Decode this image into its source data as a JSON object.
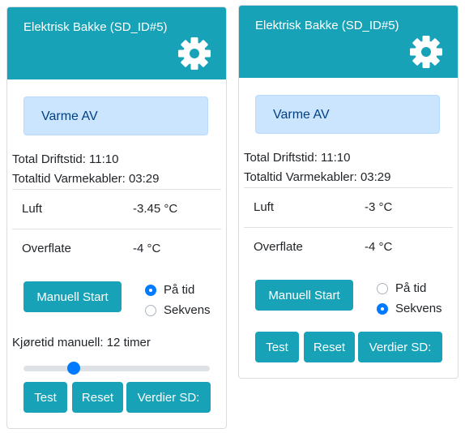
{
  "cards": [
    {
      "title": "Elektrisk Bakke (SD_ID#5)",
      "status": "Varme AV",
      "total_driftstid": "Total Driftstid: 11:10",
      "totaltid_varmekabler": "Totaltid Varmekabler: 03:29",
      "sensors": [
        {
          "name": "Luft",
          "value": "-3.45 °C"
        },
        {
          "name": "Overflate",
          "value": "-4 °C"
        }
      ],
      "manual_start": "Manuell Start",
      "mode_options": [
        "På tid",
        "Sekvens"
      ],
      "mode_selected": "På tid",
      "runtime_label": "Kjøretid manuell: 12 timer",
      "runtime_slider_fraction": 0.27,
      "buttons": [
        "Test",
        "Reset",
        "Verdier SD:"
      ]
    },
    {
      "title": "Elektrisk Bakke (SD_ID#5)",
      "status": "Varme AV",
      "total_driftstid": "Total Driftstid: 11:10",
      "totaltid_varmekabler": "Totaltid Varmekabler: 03:29",
      "sensors": [
        {
          "name": "Luft",
          "value": "-3 °C"
        },
        {
          "name": "Overflate",
          "value": "-4 °C"
        }
      ],
      "manual_start": "Manuell Start",
      "mode_options": [
        "På tid",
        "Sekvens"
      ],
      "mode_selected": "Sekvens",
      "buttons": [
        "Test",
        "Reset",
        "Verdier SD:"
      ]
    }
  ],
  "icons": {
    "settings": "gear-icon"
  },
  "colors": {
    "header": "#17a2b8",
    "alert_bg": "#cce5ff",
    "alert_text": "#004085",
    "accent": "#007bff"
  }
}
